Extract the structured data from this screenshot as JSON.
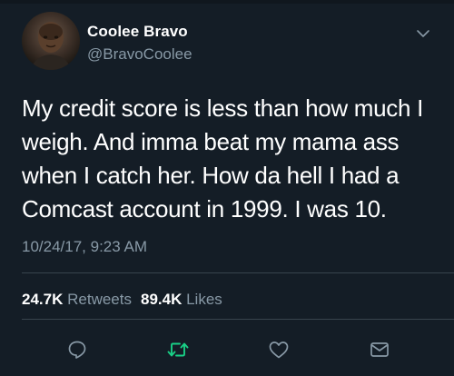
{
  "tweet": {
    "display_name": "Coolee Bravo",
    "handle": "@BravoCoolee",
    "text": "My credit score is less than how much I\nweigh. And imma beat my mama ass\nwhen I catch her. How da hell I had a\nComcast account in 1999. I was 10.",
    "timestamp": "10/24/17, 9:23 AM"
  },
  "stats": {
    "retweets_count": "24.7K",
    "retweets_label": "Retweets",
    "likes_count": "89.4K",
    "likes_label": "Likes"
  },
  "actions": {
    "reply_icon": "reply-icon",
    "retweet_icon": "retweet-icon",
    "like_icon": "heart-icon",
    "dm_icon": "mail-icon"
  },
  "colors": {
    "background": "#141d26",
    "secondary_text": "#8899a6",
    "divider": "#38444d",
    "retweet_accent": "#19cf86"
  }
}
